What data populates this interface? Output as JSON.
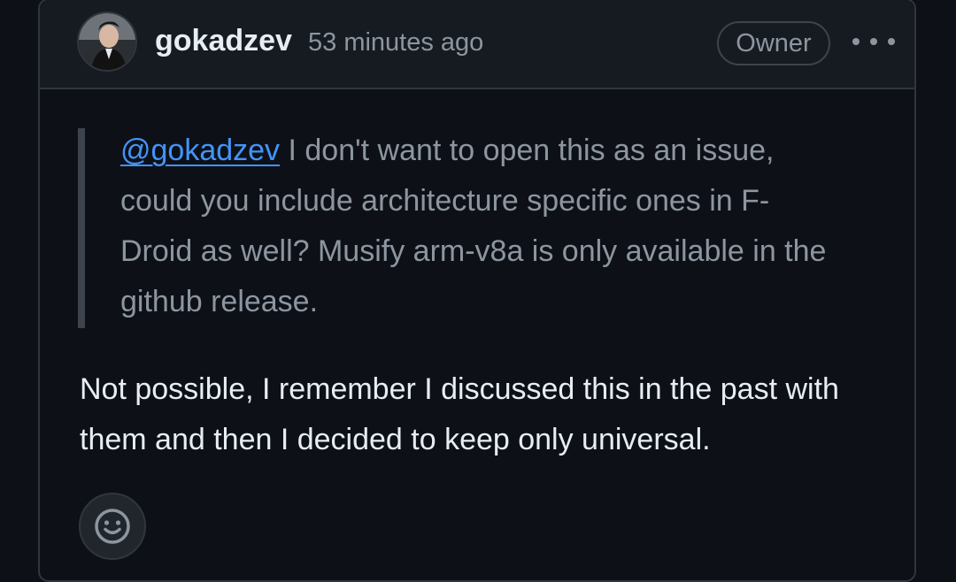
{
  "comment": {
    "author": "gokadzev",
    "timestamp": "53 minutes ago",
    "role_badge": "Owner",
    "more_icon": "kebab-horizontal-icon",
    "avatar_icon": "user-avatar",
    "quote": {
      "mention": "@gokadzev",
      "text": " I don't want to open this as an issue, could you include architecture specific ones in F-Droid as well? Musify arm-v8a is only available in the github release."
    },
    "reply": "Not possible, I remember I discussed this in the past with them and then I decided to keep only universal.",
    "reaction_icon": "smiley-icon"
  },
  "colors": {
    "background": "#0d1117",
    "header_bg": "#161b22",
    "border": "#30363d",
    "text_primary": "#e6edf3",
    "text_muted": "#8d96a0",
    "link": "#4493f8"
  }
}
